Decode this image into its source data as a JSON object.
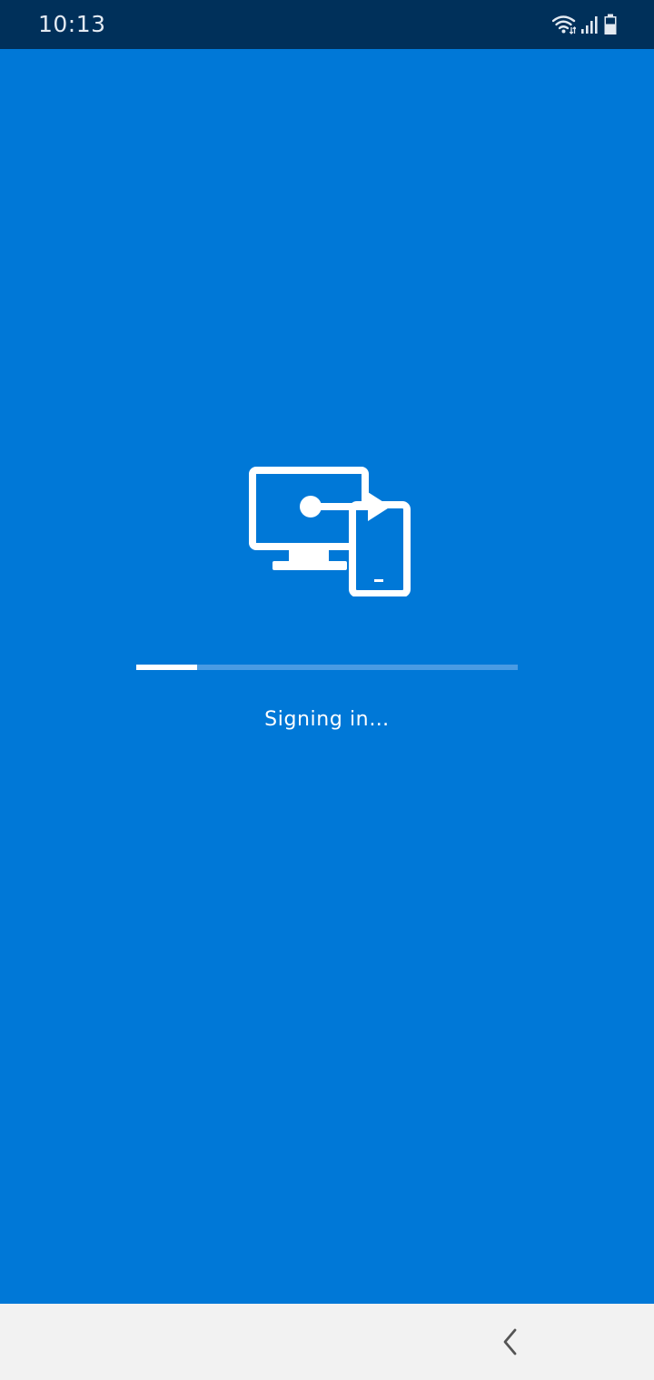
{
  "status_bar": {
    "time": "10:13",
    "icons": [
      "wifi-icon",
      "cellular-signal-icon",
      "battery-icon"
    ],
    "background": "#00305A"
  },
  "app": {
    "background": "#0078D7",
    "logo_icon": "remote-desktop-icon",
    "progress": {
      "fraction": 0.16,
      "track_color": "#4A9BE3",
      "fill_color": "#FFFFFF"
    },
    "message": "Signing in…"
  },
  "nav_bar": {
    "background": "#F2F2F2",
    "back_icon": "back-chevron-icon"
  }
}
